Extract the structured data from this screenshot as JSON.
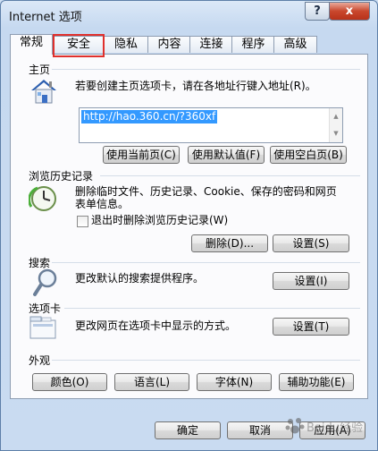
{
  "window": {
    "title": "Internet 选项",
    "help": "?",
    "close": "x"
  },
  "tabs": [
    "常规",
    "安全",
    "隐私",
    "内容",
    "连接",
    "程序",
    "高级"
  ],
  "home": {
    "title": "主页",
    "desc": "若要创建主页选项卡，请在各地址行键入地址(R)。",
    "url": "http://hao.360.cn/?360xf",
    "buttons": [
      "使用当前页(C)",
      "使用默认值(F)",
      "使用空白页(B)"
    ]
  },
  "history": {
    "title": "浏览历史记录",
    "desc_line1": "删除临时文件、历史记录、Cookie、保存的密码和网页",
    "desc_line2": "表单信息。",
    "checkbox": "退出时删除浏览历史记录(W)",
    "delete": "删除(D)...",
    "settings": "设置(S)"
  },
  "search": {
    "title": "搜索",
    "desc": "更改默认的搜索提供程序。",
    "settings": "设置(I)"
  },
  "tabs_section": {
    "title": "选项卡",
    "desc": "更改网页在选项卡中显示的方式。",
    "settings": "设置(T)"
  },
  "appearance": {
    "title": "外观",
    "buttons": [
      "颜色(O)",
      "语言(L)",
      "字体(N)",
      "辅助功能(E)"
    ]
  },
  "footer": {
    "ok": "确定",
    "cancel": "取消",
    "apply": "应用(A)"
  },
  "watermark": "Baidu经验"
}
